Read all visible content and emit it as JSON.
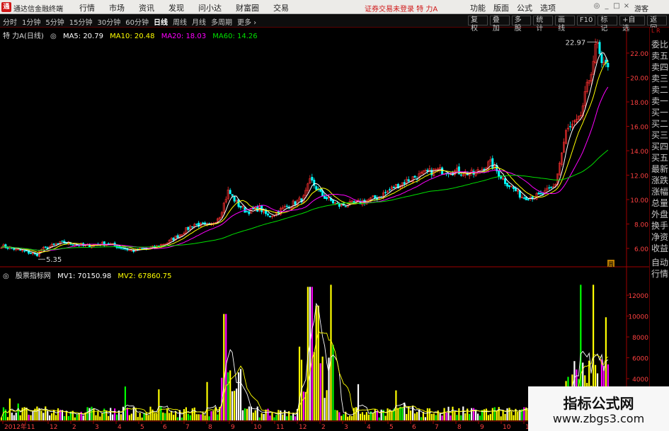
{
  "app": {
    "title": "通达信金融终端",
    "logo_char": "通",
    "menu": [
      "行情",
      "市场",
      "资讯",
      "发现",
      "问小达",
      "财富圈",
      "交易"
    ],
    "status": "证券交易未登录  特 力A",
    "right_menu": [
      "功能",
      "版面",
      "公式",
      "选项"
    ],
    "window_buttons": [
      "◎",
      "_",
      "□",
      "×"
    ],
    "guest_label": "游客"
  },
  "toolbar": {
    "periods": [
      "分时",
      "1分钟",
      "5分钟",
      "15分钟",
      "30分钟",
      "60分钟",
      "日线",
      "周线",
      "月线",
      "多周期",
      "更多 ›"
    ],
    "active_period": "日线",
    "tools": [
      "复权",
      "叠加",
      "多股",
      "统计",
      "画线",
      "F10",
      "标记",
      "+自选",
      "返回"
    ]
  },
  "price_panel": {
    "stock": "特 力A(日线)",
    "ma": [
      {
        "label": "MA5: 20.79",
        "color": "#ffffff"
      },
      {
        "label": "MA10: 20.48",
        "color": "#ffff00"
      },
      {
        "label": "MA20: 18.03",
        "color": "#ff00ff"
      },
      {
        "label": "MA60: 14.26",
        "color": "#00e000"
      }
    ],
    "high_label": "22.97",
    "low_label": "5.35",
    "y_ticks": [
      "22.00",
      "20.00",
      "18.00",
      "16.00",
      "14.00",
      "12.00",
      "10.00",
      "8.00",
      "6.00"
    ],
    "y_values": [
      22,
      20,
      18,
      16,
      14,
      12,
      10,
      8,
      6
    ],
    "corner_badge": "周"
  },
  "volume_panel": {
    "indicator": "股票指标网",
    "mv": [
      {
        "label": "MV1: 70150.98",
        "color": "#ffffff"
      },
      {
        "label": "MV2: 67860.75",
        "color": "#ffff00"
      }
    ],
    "y_ticks": [
      "12000",
      "10000",
      "8000",
      "6000",
      "4000"
    ],
    "y_values": [
      12000,
      10000,
      8000,
      6000,
      4000
    ]
  },
  "x_axis": {
    "labels": [
      "2012年",
      "11",
      "12",
      "2",
      "3",
      "4",
      "5",
      "6",
      "7",
      "8",
      "9",
      "10",
      "11",
      "12",
      "2",
      "3",
      "4",
      "5",
      "6",
      "7",
      "8",
      "9",
      "10",
      "11"
    ]
  },
  "right_panel": {
    "top_label": "L R",
    "items": [
      "委比",
      "卖五",
      "卖四",
      "卖三",
      "卖二",
      "卖一",
      "买一",
      "买二",
      "买三",
      "买四",
      "买五",
      "最新",
      "涨跌",
      "涨幅",
      "总量",
      "外盘",
      "换手",
      "净资",
      "收益",
      "自动",
      "行情"
    ]
  },
  "watermark": {
    "line1": "指标公式网",
    "line2": "www.zbgs3.com"
  },
  "colors": {
    "up": "#ff3030",
    "down": "#00ffff",
    "ma5": "#ffffff",
    "ma10": "#ffff00",
    "ma20": "#ff00ff",
    "ma60": "#00e000",
    "vol_yellow": "#ffff00",
    "vol_white": "#ffffff",
    "vol_green": "#00ff00",
    "vol_magenta": "#ff00ff",
    "axis_red": "#a00000"
  }
}
